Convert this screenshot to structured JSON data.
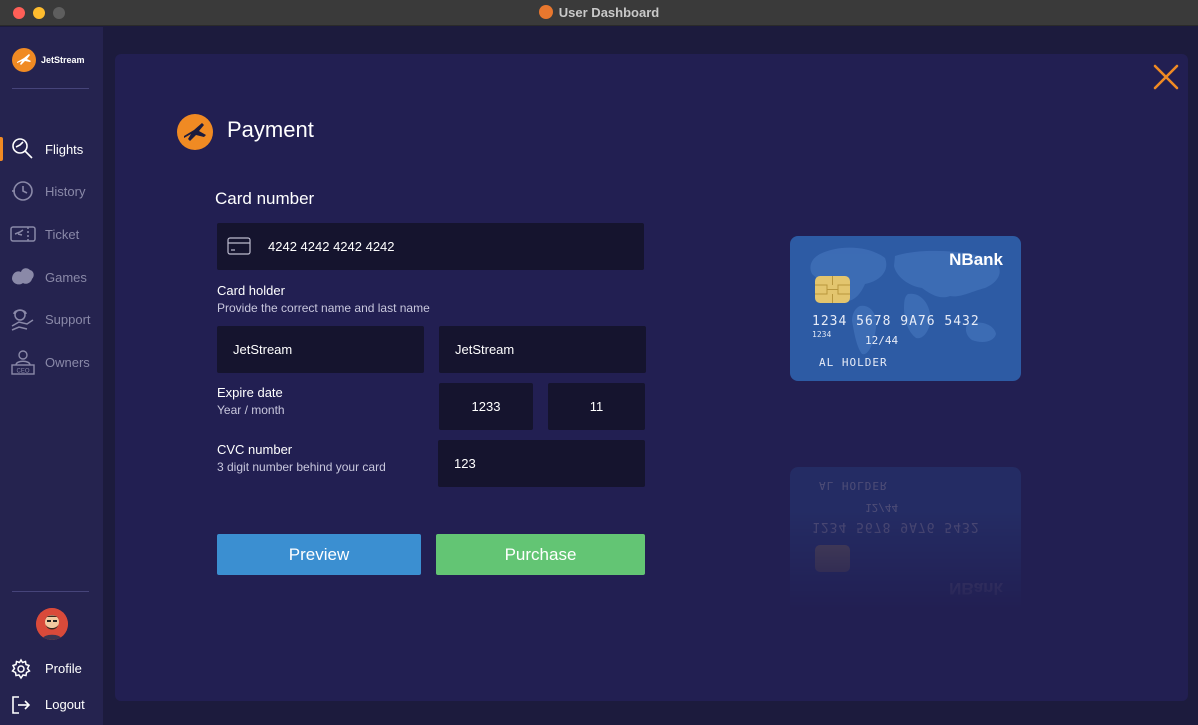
{
  "window": {
    "title": "User Dashboard"
  },
  "brand": {
    "name": "JetStream"
  },
  "sidebar": {
    "items": [
      {
        "label": "Flights",
        "icon": "flights-search-icon",
        "active": true
      },
      {
        "label": "History",
        "icon": "history-clock-icon",
        "active": false
      },
      {
        "label": "Ticket",
        "icon": "ticket-icon",
        "active": false
      },
      {
        "label": "Games",
        "icon": "games-icon",
        "active": false
      },
      {
        "label": "Support",
        "icon": "support-icon",
        "active": false
      },
      {
        "label": "Owners",
        "icon": "owners-ceo-icon",
        "active": false
      }
    ],
    "bottom": {
      "profile_label": "Profile",
      "logout_label": "Logout"
    }
  },
  "payment": {
    "title": "Payment",
    "card_number_label": "Card number",
    "card_number_value": "4242 4242 4242 4242",
    "card_holder_label": "Card holder",
    "card_holder_hint": "Provide the correct name and last name",
    "first_name_value": "JetStream",
    "last_name_value": "JetStream",
    "expire_label": "Expire date",
    "expire_hint": "Year / month",
    "expire_year_value": "1233",
    "expire_month_value": "11",
    "cvc_label": "CVC number",
    "cvc_hint": "3 digit number behind your card",
    "cvc_value": "123",
    "preview_label": "Preview",
    "purchase_label": "Purchase"
  },
  "card_preview": {
    "bank": "NBank",
    "number": "1234 5678 9A76 5432",
    "small_number": "1234",
    "expiry": "12/44",
    "holder": "AL  HOLDER"
  },
  "colors": {
    "accent": "#f08a23",
    "preview": "#3b8fd1",
    "purchase": "#63c574",
    "panel": "#221f52",
    "field": "#15142e",
    "card": "#2d5ba4"
  }
}
